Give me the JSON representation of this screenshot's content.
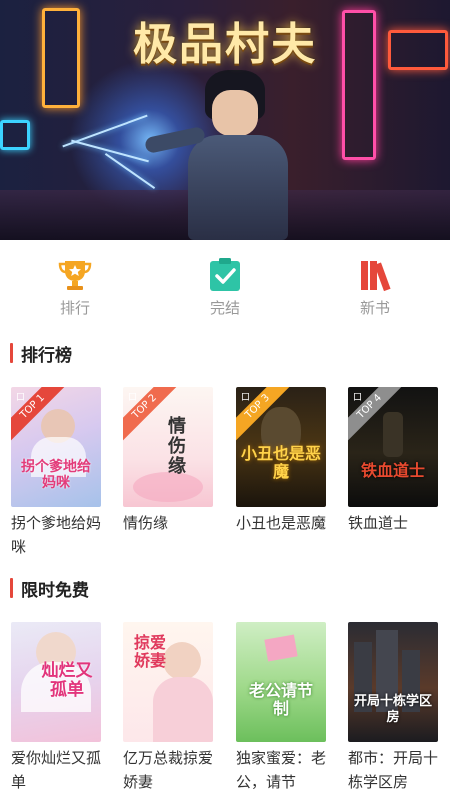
{
  "banner": {
    "title": "极品村夫"
  },
  "categories": [
    {
      "label": "排行",
      "icon": "trophy-icon"
    },
    {
      "label": "完结",
      "icon": "clipboard-check-icon"
    },
    {
      "label": "新书",
      "icon": "books-icon"
    }
  ],
  "ranking": {
    "title": "排行榜",
    "books": [
      {
        "name": "拐个爹地给妈咪",
        "cover_title": "拐个爹地给妈咪",
        "rank": "TOP 1",
        "badge": "口"
      },
      {
        "name": "情伤缘",
        "cover_title": "情伤缘",
        "rank": "TOP 2",
        "badge": "口"
      },
      {
        "name": "小丑也是恶魔",
        "cover_title": "小丑也是恶魔",
        "rank": "TOP 3",
        "badge": "口"
      },
      {
        "name": "铁血道士",
        "cover_title": "铁血道士",
        "rank": "TOP 4",
        "badge": "口"
      }
    ]
  },
  "free": {
    "title": "限时免费",
    "books": [
      {
        "name": "爱你灿烂又孤单",
        "cover_title": "灿烂又孤单"
      },
      {
        "name": "亿万总裁掠爱娇妻",
        "cover_title": "掠爱娇妻"
      },
      {
        "name": "独家蜜爱：老公，请节",
        "cover_title": "老公请节制"
      },
      {
        "name": "都市：开局十栋学区房",
        "cover_title": "开局十栋学区房"
      }
    ]
  },
  "colors": {
    "accent": "#e5473b",
    "trophy": "#f5a623",
    "check": "#2ec4a6",
    "books": "#e5473b"
  }
}
